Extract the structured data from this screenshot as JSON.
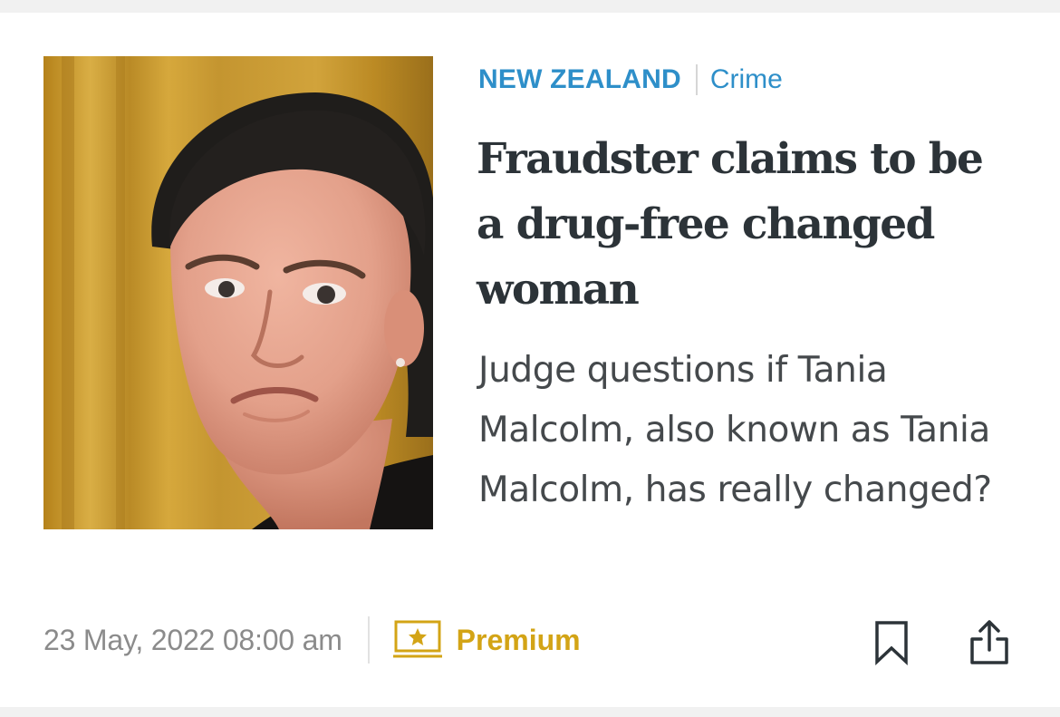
{
  "article": {
    "section": "NEW ZEALAND",
    "topic": "Crime",
    "headline": "Fraudster claims to be a drug-free changed woman",
    "standfirst": "Judge questions if Tania Malcolm, also known as Tania Malcolm, has really changed?",
    "date": "23 May, 2022 08:00 am",
    "premium_label": "Premium"
  },
  "icons": {
    "premium": "premium-star-icon",
    "bookmark": "bookmark-icon",
    "share": "share-icon"
  },
  "colors": {
    "section": "#2e8fc9",
    "headline": "#2c3338",
    "standfirst": "#45494c",
    "date": "#8b8b8b",
    "premium": "#d3a416"
  }
}
